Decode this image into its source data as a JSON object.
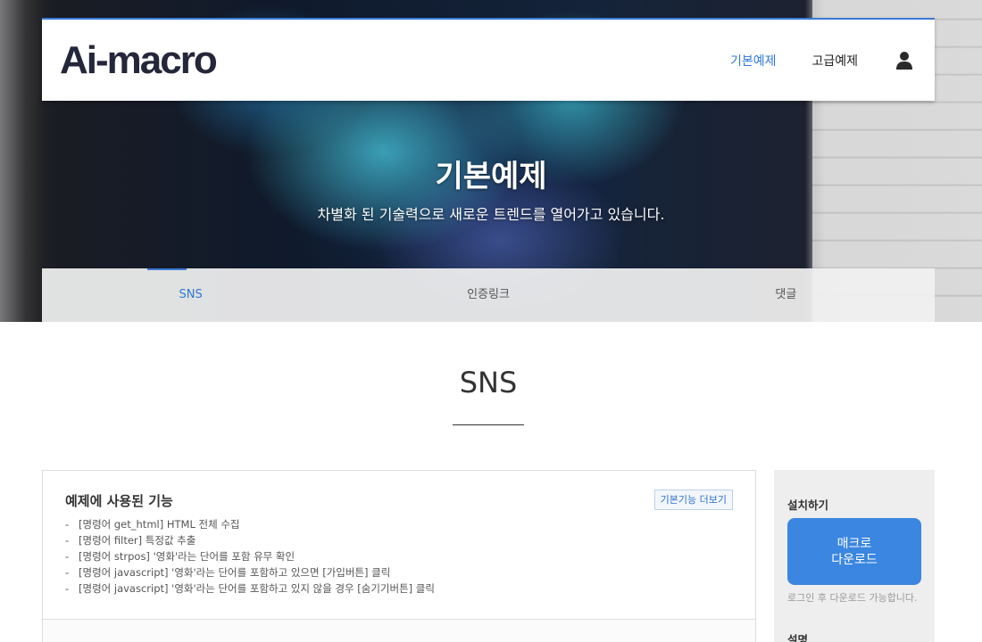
{
  "header": {
    "logo": "Ai-macro",
    "nav": [
      {
        "label": "기본예제",
        "active": true
      },
      {
        "label": "고급예제",
        "active": false
      }
    ],
    "user_icon": "user-icon"
  },
  "hero": {
    "title": "기본예제",
    "subtitle": "차별화 된 기술력으로 새로운 트렌드를 열어가고 있습니다."
  },
  "tabs": [
    {
      "label": "SNS",
      "active": true
    },
    {
      "label": "인증링크",
      "active": false
    },
    {
      "label": "댓글",
      "active": false
    }
  ],
  "section": {
    "title": "SNS"
  },
  "feature": {
    "title": "예제에 사용된 기능",
    "more_button": "기본기능 더보기",
    "items": [
      "[명령어 get_html] HTML 전체 수집",
      "[명령어 filter] 특정값 추출",
      "[명령어 strpos] '영화'라는 단어를 포함 유무 확인",
      "[명령어 javascript] '영화'라는 단어를 포함하고 있으면 [가입버튼] 클릭",
      "[명령어 javascript] '영화'라는 단어를 포함하고 있지 않을 경우 [숨기기버튼] 클릭"
    ]
  },
  "sidebar": {
    "install_heading": "설치하기",
    "download_line1": "매크로",
    "download_line2": "다운로드",
    "note": "로그인 후 다운로드 가능합니다.",
    "desc_heading": "설명"
  },
  "colors": {
    "accent": "#3a7bd5",
    "download_button": "#3a86e0",
    "logo": "#24263a"
  }
}
